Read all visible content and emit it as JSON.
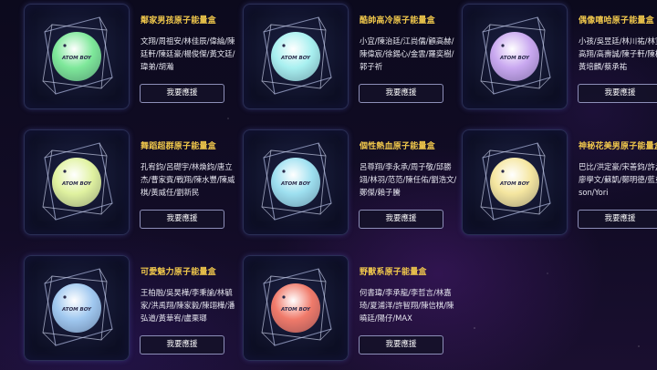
{
  "vote_label": "我要應援",
  "boxes": [
    {
      "title": "鄰家男孩原子能量盒",
      "members": "文翔/周祖安/林佳辰/偉綸/陳廷軒/陳廷豪/楊俊傑/黃文廷/瑋弟/胡瀚",
      "ball_color": "#7ee89a"
    },
    {
      "title": "酷帥高冷原子能量盒",
      "members": "小宜/陳治廷/江尚儒/顧高赫/陳偉宸/徐錫心/金雲/羅奕樹/郭子祈",
      "ball_color": "#a8f0f0"
    },
    {
      "title": "偶像嘻哈原子能量盒",
      "members": "小孩/吳昱廷/林川祐/林宣豪/高翔/高壽誠/陳子軒/陳柏錡/黃培麟/蔡承祐",
      "ball_color": "#c9a8f0"
    },
    {
      "title": "舞蹈超群原子能量盒",
      "members": "孔宥鈞/呂礎宇/林煥鈞/唐立杰/曹家賓/戰翔/陳水豐/陳威棋/黃威任/劉新民",
      "ball_color": "#e0f2a0"
    },
    {
      "title": "個性熱血原子能量盒",
      "members": "呂尊翔/李永承/周子敬/邱勝翊/林羽/范范/陳任佑/劉浩文/鄭傑/賴子騰",
      "ball_color": "#9ee0f0"
    },
    {
      "title": "神秘花美男原子能量盒",
      "members": "巴比/洪定豪/宋善鈞/許孟維/廖學文/蘇凱/鄭明德/藍弟/Nelson/Yori",
      "ball_color": "#f5e6a0"
    },
    {
      "title": "可愛魅力原子能量盒",
      "members": "王柏融/吳昊樺/李秉諭/林毓家/洪禹翔/陳家毅/陳翊樺/潘弘道/黃華宥/盧栗瑯",
      "ball_color": "#a0c8f0"
    },
    {
      "title": "野獸系原子能量盒",
      "members": "何書瑋/李承龍/李哲言/林嘉琦/夏浦洋/許智翔/陳信棋/陳曉廷/陽仔/MAX",
      "ball_color": "#f07a6a"
    }
  ]
}
